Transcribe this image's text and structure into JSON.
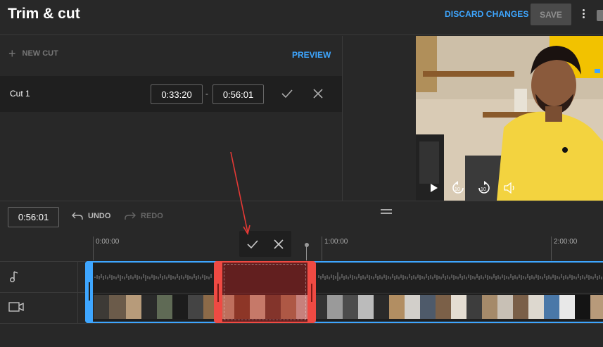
{
  "header": {
    "title": "Trim & cut",
    "discard_label": "DISCARD CHANGES",
    "save_label": "SAVE"
  },
  "cuts_panel": {
    "new_cut_label": "NEW CUT",
    "preview_label": "PREVIEW",
    "cut": {
      "label": "Cut 1",
      "start": "0:33:20",
      "separator": "-",
      "end": "0:56:01"
    }
  },
  "player": {
    "icons": [
      "play-icon",
      "rewind-10-icon",
      "forward-10-icon",
      "volume-icon"
    ]
  },
  "timeline": {
    "current_time": "0:56:01",
    "undo_label": "UNDO",
    "redo_label": "REDO",
    "ruler": [
      "0:00:00",
      "1:00:00",
      "2:00:00"
    ],
    "tracks": [
      "music-note-icon",
      "video-camera-icon"
    ]
  },
  "colors": {
    "accent": "#3ea6ff",
    "cut_selection": "#ef4a43",
    "background": "#282828"
  }
}
